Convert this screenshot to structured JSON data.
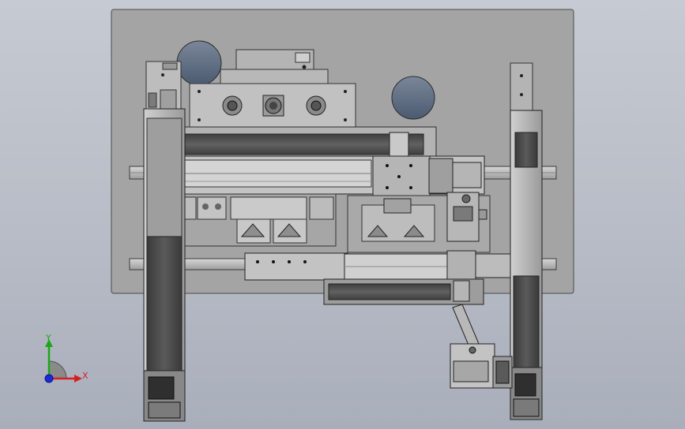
{
  "triad": {
    "x_label": "X",
    "y_label": "Y",
    "x_color": "#d62020",
    "y_color": "#1aa81a",
    "z_color": "#1a2ad8"
  },
  "colors": {
    "background": "#bcc1ca",
    "base_plate": "#a3a3a3",
    "steel": "#b9b9b9",
    "dark_rail": "#4a4a4a",
    "bore": "#5f6f84"
  }
}
